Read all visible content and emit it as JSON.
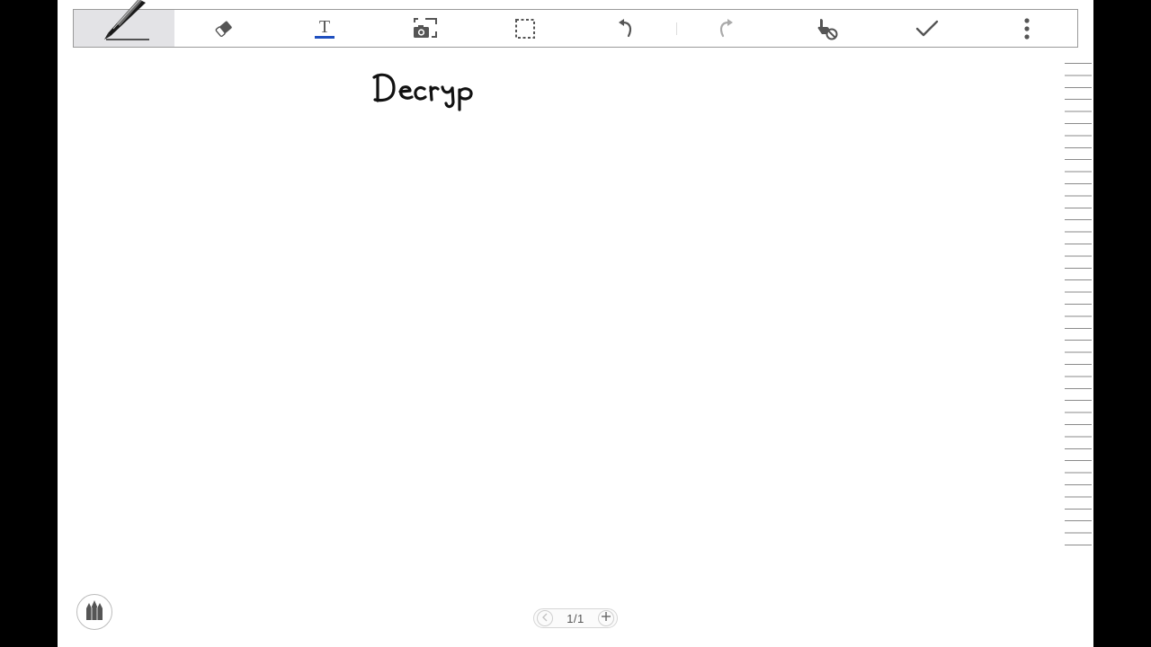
{
  "toolbar": {
    "tools": [
      {
        "icon": "pen-icon",
        "active": true
      },
      {
        "icon": "eraser-icon"
      },
      {
        "icon": "text-icon",
        "accent": "#1f4fbf"
      },
      {
        "icon": "screenshot-icon"
      },
      {
        "icon": "selection-icon"
      },
      {
        "icon": "undo-icon"
      },
      {
        "icon": "redo-icon",
        "disabled": true
      },
      {
        "icon": "touch-disable-icon"
      },
      {
        "icon": "done-check-icon"
      },
      {
        "icon": "more-vertical-icon"
      }
    ]
  },
  "canvas": {
    "handwritten_text": "Decryp"
  },
  "pager": {
    "page_indicator": "1/1"
  },
  "colors": {
    "accent": "#1f4fbf",
    "ink": "#111111",
    "icon": "#555555",
    "icon_disabled": "#aaaaaa",
    "active_tool_bg": "#e3e3e6"
  }
}
